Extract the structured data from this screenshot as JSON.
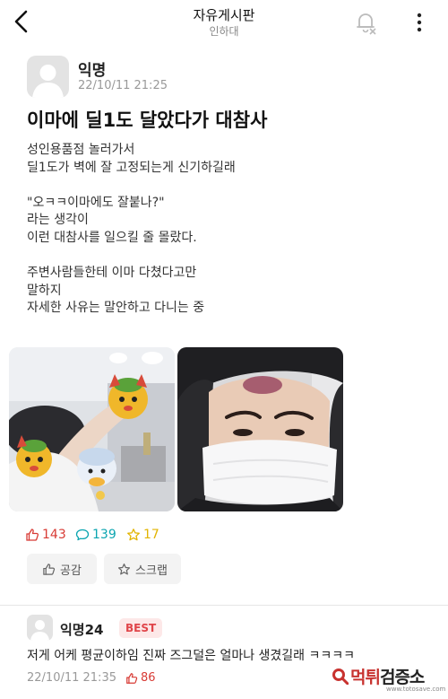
{
  "header": {
    "title": "자유게시판",
    "subtitle": "인하대",
    "icons": [
      "back-arrow-icon",
      "bell-off-icon",
      "more-vertical-icon"
    ]
  },
  "post": {
    "author": "익명",
    "date": "22/10/11 21:25",
    "title": "이마에 딜1도 달았다가 대참사",
    "body_lines": [
      "성인용품점 놀러가서",
      "딜1도가 벽에 잘 고정되는게 신기하길래",
      "",
      "\"오ㅋㅋ이마에도 잘붙나?\"",
      "라는 생각이",
      "이런 대참사를 일으킬 줄 몰랐다.",
      "",
      "주변사람들한테 이마 다쳤다고만",
      "말하지",
      "자세한 사유는 말안하고 다니는 중"
    ],
    "likes": "143",
    "comments": "139",
    "scraps": "17",
    "like_button": "공감",
    "scrap_button": "스크랩"
  },
  "comment": {
    "author": "익명24",
    "badge": "BEST",
    "text": "저게 어케 평균이하임 진짜 즈그덜은 얼마나 생겼길래 ㅋㅋㅋㅋ",
    "date": "22/10/11 21:35",
    "likes": "86"
  },
  "watermark": {
    "text_red": "먹튀",
    "text_dark": "검증소",
    "sub": "www.totosave.com"
  },
  "colors": {
    "like": "#d83b35",
    "comment": "#0ca5b0",
    "scrap": "#e2b400",
    "best_bg": "#fde8e8",
    "best_text": "#e0454a"
  }
}
